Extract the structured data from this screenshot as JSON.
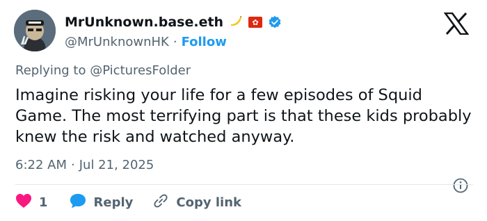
{
  "author": {
    "display_name": "MrUnknown.base.eth",
    "handle": "@MrUnknownHK",
    "separator": "·",
    "follow_label": "Follow",
    "verified_color": "#1d9bf0",
    "emojis": [
      "banana-icon",
      "hong-kong-flag-icon"
    ]
  },
  "reply_context": {
    "prefix": "Replying to",
    "target": "@PicturesFolder"
  },
  "tweet": {
    "text": "Imagine risking your life for a few episodes of Squid Game. The most terrifying part is that these kids probably knew the risk and watched anyway.",
    "time": "6:22 AM",
    "separator": "·",
    "date": "Jul 21, 2025"
  },
  "actions": {
    "like_count": "1",
    "reply_label": "Reply",
    "copy_link_label": "Copy link"
  },
  "colors": {
    "accent": "#1d9bf0",
    "like": "#f91880",
    "text": "#0f1419",
    "muted": "#536471"
  }
}
